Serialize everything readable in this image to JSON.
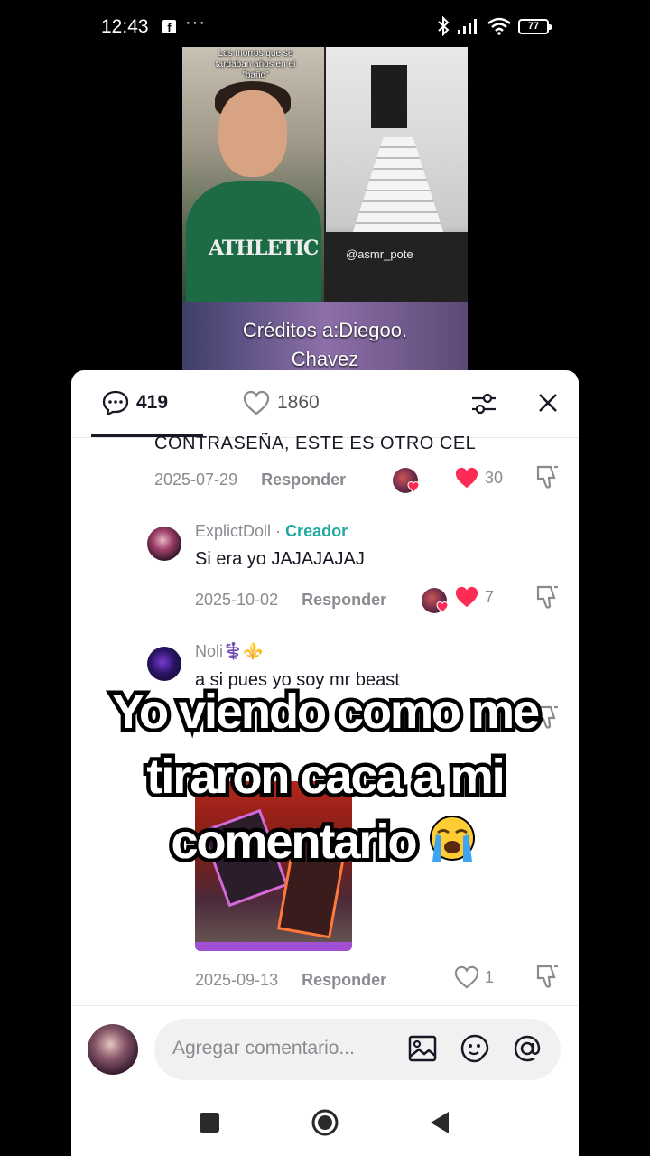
{
  "status_bar": {
    "time": "12:43",
    "dots": "···",
    "battery": "77"
  },
  "video": {
    "overlay_text": "Los morros que se tardaban años en el \"baño\"",
    "watermark": "@asmr_pote",
    "credits_line1": "Créditos a:Diegoo.",
    "credits_line2": "Chavez"
  },
  "header": {
    "comment_count": "419",
    "like_count": "1860"
  },
  "comments": [
    {
      "text": "CONTRASEÑA, ESTE ES OTRO CEL",
      "date": "2025-07-29",
      "reply_label": "Responder",
      "likes": "30",
      "liked": true
    },
    {
      "author": "ExplictDoll",
      "separator": "·",
      "badge": "Creador",
      "text": "Si era yo JAJAJAJAJ",
      "date": "2025-10-02",
      "reply_label": "Responder",
      "likes": "7",
      "liked": true
    },
    {
      "author": "Noli⚕️⚜️",
      "text": "a si pues yo soy mr beast"
    },
    {
      "date": "2025-09-13",
      "reply_label": "Responder",
      "likes": "1",
      "liked": false
    }
  ],
  "input": {
    "placeholder": "Agregar comentario..."
  },
  "caption": {
    "line1": "Yo viendo como me",
    "line2": "tiraron caca a mi",
    "line3": "comentario"
  },
  "colors": {
    "like_red": "#fe2c55",
    "creator_teal": "#20a9a0",
    "text_dark": "#161823",
    "muted": "#8a8b91"
  }
}
